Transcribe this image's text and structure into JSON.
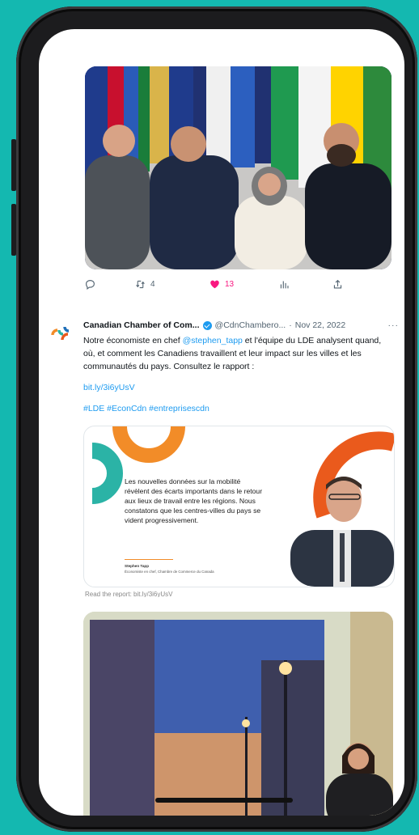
{
  "post1": {
    "actions": {
      "replies": "",
      "retweets": "4",
      "likes": "13"
    }
  },
  "tweet": {
    "author_name": "Canadian Chamber of Com...",
    "handle": "@CdnChambero...",
    "separator": "·",
    "date": "Nov 22, 2022",
    "more": "···",
    "text_1": "Notre économiste en chef ",
    "mention": "@stephen_tapp",
    "text_2": " et l'équipe du LDE analysent quand, où, et comment les Canadiens travaillent et leur impact sur les villes et les communautés du pays. Consultez le rapport :",
    "link": "bit.ly/3i6yUsV",
    "hashtags": "#LDE #EconCdn #entreprisescdn",
    "card": {
      "body": "Les nouvelles données sur la mobilité révèlent des écarts importants dans le retour aux lieux de travail entre les régions. Nous constatons que les centres-villes du pays se vident progressivement.",
      "signature_name": "Stephen Tapp",
      "signature_role": "Économiste en chef, Chambre de Commerce du Canada"
    },
    "trailing_text": "Read the report: bit.ly/3i6yUsV"
  },
  "colors": {
    "background": "#14b8b0",
    "link": "#1d9bf0",
    "like": "#f91880",
    "card_teal": "#2bb3a6",
    "card_orange": "#f28c28",
    "card_red_orange": "#ea5a1c"
  },
  "icons": [
    "reply-icon",
    "retweet-icon",
    "like-icon",
    "views-icon",
    "share-icon",
    "verified-icon",
    "more-icon"
  ]
}
